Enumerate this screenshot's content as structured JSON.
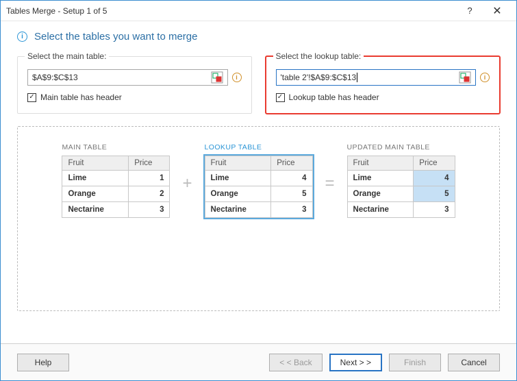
{
  "window": {
    "title": "Tables Merge - Setup 1 of 5"
  },
  "instruction": "Select the tables you want to merge",
  "main_panel": {
    "label": "Select the main table:",
    "value": "$A$9:$C$13",
    "checkbox_label": "Main table has header"
  },
  "lookup_panel": {
    "label": "Select the lookup table:",
    "value": "'table 2'!$A$9:$C$13",
    "checkbox_label": "Lookup table has header"
  },
  "preview": {
    "main_title": "MAIN TABLE",
    "lookup_title": "LOOKUP TABLE",
    "updated_title": "UPDATED MAIN TABLE",
    "col1": "Fruit",
    "col2": "Price",
    "main_rows": [
      {
        "fruit": "Lime",
        "price": "1"
      },
      {
        "fruit": "Orange",
        "price": "2"
      },
      {
        "fruit": "Nectarine",
        "price": "3"
      }
    ],
    "lookup_rows": [
      {
        "fruit": "Lime",
        "price": "4"
      },
      {
        "fruit": "Orange",
        "price": "5"
      },
      {
        "fruit": "Nectarine",
        "price": "3"
      }
    ],
    "updated_rows": [
      {
        "fruit": "Lime",
        "price": "4",
        "hl": true
      },
      {
        "fruit": "Orange",
        "price": "5",
        "hl": true
      },
      {
        "fruit": "Nectarine",
        "price": "3",
        "hl": false
      }
    ]
  },
  "buttons": {
    "help": "Help",
    "back": "< < Back",
    "next": "Next > >",
    "finish": "Finish",
    "cancel": "Cancel"
  }
}
